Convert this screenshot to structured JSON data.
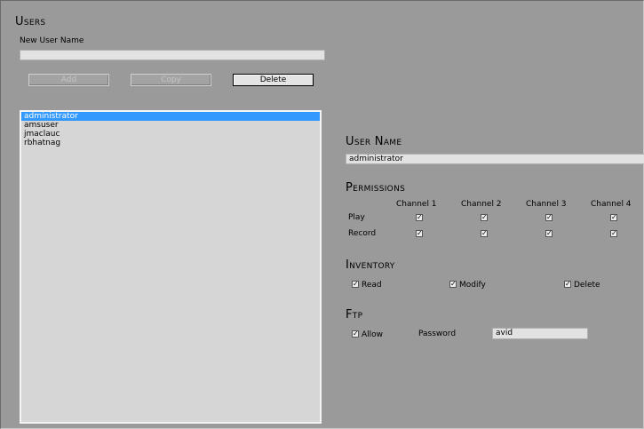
{
  "users_section": {
    "title": "Users",
    "new_user_label": "New User Name",
    "new_user_value": "",
    "add_label": "Add",
    "copy_label": "Copy",
    "delete_label": "Delete",
    "users": [
      "administrator",
      "amsuser",
      "jmaclauc",
      "rbhatnag"
    ],
    "selected_user": "administrator"
  },
  "detail": {
    "user_name_title": "User Name",
    "user_name_value": "administrator",
    "permissions_title": "Permissions",
    "channels": [
      "Channel 1",
      "Channel 2",
      "Channel 3",
      "Channel 4"
    ],
    "rows": [
      {
        "label": "Play",
        "checked": [
          true,
          true,
          true,
          true
        ]
      },
      {
        "label": "Record",
        "checked": [
          true,
          true,
          true,
          true
        ]
      }
    ],
    "inventory_title": "Inventory",
    "inventory": [
      {
        "label": "Read",
        "checked": true
      },
      {
        "label": "Modify",
        "checked": true
      },
      {
        "label": "Delete",
        "checked": true
      }
    ],
    "ftp_title": "Ftp",
    "ftp_allow_label": "Allow",
    "ftp_allow_checked": true,
    "password_label": "Password",
    "password_value": "avid"
  }
}
